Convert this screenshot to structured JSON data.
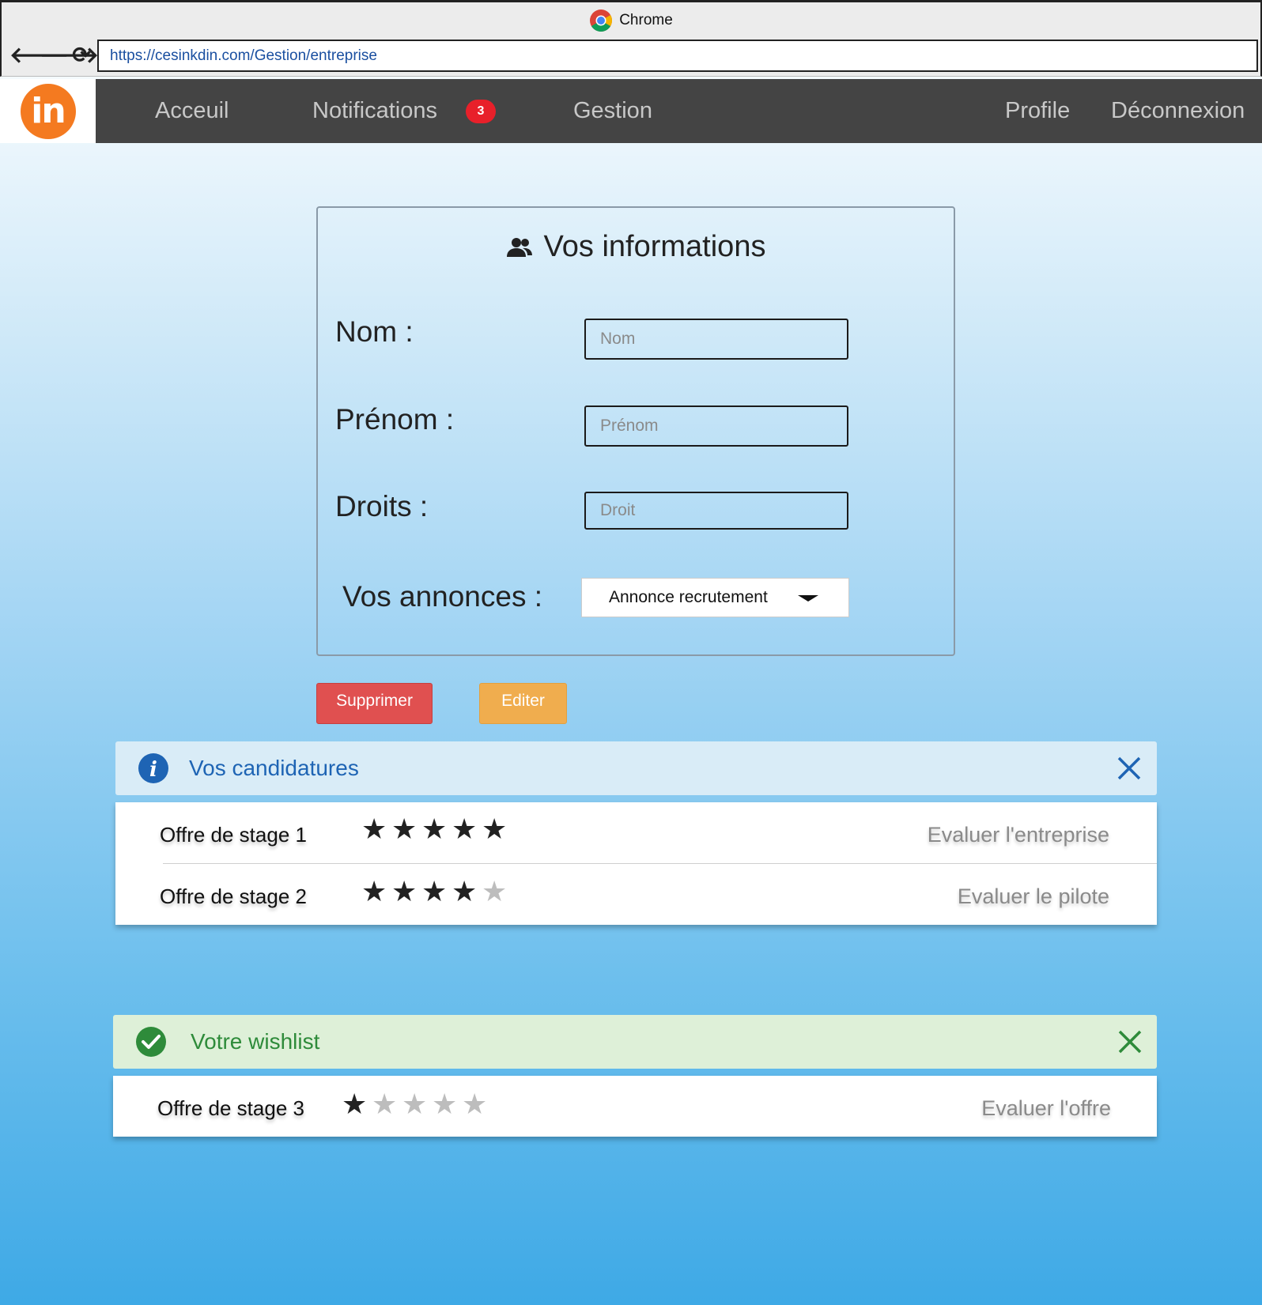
{
  "browser": {
    "app_name": "Chrome",
    "url": "https://cesinkdin.com/Gestion/entreprise",
    "nav": {
      "back": "🡐",
      "forward": "🡒",
      "reload": "⟳"
    }
  },
  "topnav": {
    "logo_text": "in",
    "items": {
      "home": "Acceuil",
      "notifications": "Notifications",
      "management": "Gestion",
      "profile": "Profile",
      "logout": "Déconnexion"
    },
    "notification_count": "3",
    "colors": {
      "bar": "#444444",
      "logo": "#f47a20",
      "badge": "#e8202a"
    }
  },
  "info_panel": {
    "title": "Vos informations",
    "title_icon": "users-icon",
    "fields": {
      "nom": {
        "label": "Nom :",
        "placeholder": "Nom",
        "value": ""
      },
      "prenom": {
        "label": "Prénom :",
        "placeholder": "Prénom",
        "value": ""
      },
      "droits": {
        "label": "Droits :",
        "placeholder": "Droit",
        "value": ""
      }
    },
    "annonces": {
      "label": "Vos annonces :",
      "selected": "Annonce recrutement"
    }
  },
  "actions": {
    "delete": "Supprimer",
    "edit": "Editer"
  },
  "candidatures": {
    "title": "Vos candidatures",
    "icon": "info-icon",
    "rows": [
      {
        "title": "Offre de stage 1",
        "rating": 5,
        "max": 5,
        "action": "Evaluer l'entreprise"
      },
      {
        "title": "Offre de stage 2",
        "rating": 4,
        "max": 5,
        "action": "Evaluer le pilote"
      }
    ]
  },
  "wishlist": {
    "title": "Votre wishlist",
    "icon": "check-circle-icon",
    "rows": [
      {
        "title": "Offre de stage 3",
        "rating": 1,
        "max": 5,
        "action": "Evaluer l'offre"
      }
    ]
  }
}
